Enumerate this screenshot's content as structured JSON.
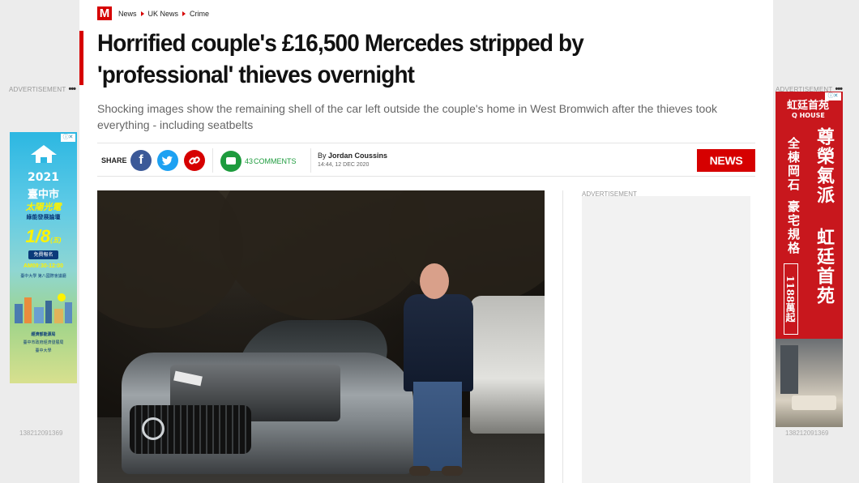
{
  "breadcrumbs": {
    "logo": "M",
    "items": [
      "News",
      "UK News",
      "Crime"
    ]
  },
  "article": {
    "headline": "Horrified couple's £16,500 Mercedes stripped by 'professional' thieves overnight",
    "standfirst": "Shocking images show the remaining shell of the car left outside the couple's home in West Bromwich after the thieves took everything - including seatbelts",
    "section_badge": "NEWS",
    "author_prefix": "By",
    "author": "Jordan Coussins",
    "published": "14:44, 12 DEC 2020"
  },
  "share": {
    "label": "SHARE",
    "comment_count": "43",
    "comment_label": "COMMENTS"
  },
  "ads": {
    "label": "ADVERTISEMENT",
    "dots": "•••",
    "left_id": "138212091369",
    "right_id": "138212091369",
    "mpu_label": "ADVERTISEMENT",
    "left_creative": {
      "year": "2021",
      "city": "臺中市",
      "headline": "太陽光電",
      "subline": "綠能發展論壇",
      "date": "1/8",
      "date_suffix": "(五)",
      "cta": "免費報名",
      "time": "AM09:30-12:00",
      "venue": "臺中大學 第八國際會議廳",
      "footer_1": "經濟部能源局",
      "footer_2": "臺中市政府經濟發展局",
      "footer_3": "臺中大學"
    },
    "right_creative": {
      "brand": "虹廷首苑",
      "brand_en": "Q HOUSE",
      "line_1": "尊榮氣派",
      "line_2": "虹廷首苑",
      "line_3": "全棟岡石",
      "line_4": "豪宅規格",
      "price": "1188萬起"
    }
  },
  "colors": {
    "brand_red": "#d60000",
    "facebook": "#3b5998",
    "twitter": "#1da1f2",
    "comments_green": "#1d9b3d"
  },
  "icons": {
    "facebook": "f",
    "twitter": "bird",
    "link": "∞"
  }
}
